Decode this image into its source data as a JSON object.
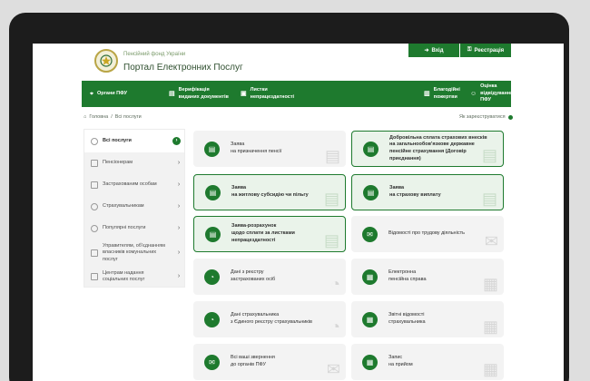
{
  "header": {
    "fund_name": "Пенсійний фонд України",
    "portal_title": "Портал Електронних Послуг",
    "login": "Вхід",
    "register": "Реєстрація"
  },
  "nav": {
    "items": [
      {
        "label": "Органи ПФУ",
        "icon": "map-icon"
      },
      {
        "label_1": "Верифікація",
        "label_2": "виданих документів",
        "icon": "document-check-icon"
      },
      {
        "label_1": "Листки",
        "label_2": "непрацездатності",
        "icon": "camera-icon"
      },
      {
        "label_1": "Благодійні",
        "label_2": "пожертви",
        "icon": "gift-icon"
      },
      {
        "label_1": "Оцінка",
        "label_2": "відвідування ПФУ",
        "icon": "rating-icon"
      }
    ]
  },
  "breadcrumb": {
    "home": "Головна",
    "separator": "/",
    "current": "Всі послуги"
  },
  "register_status": "Як зареєструватися",
  "sidebar": {
    "items": [
      {
        "label": "Всі послуги",
        "active": true
      },
      {
        "label": "Пенсіонерам"
      },
      {
        "label": "Застрахованим особам"
      },
      {
        "label": "Страхувальникам"
      },
      {
        "label": "Популярні послуги"
      },
      {
        "label": "Управителям, об'єднанням власників комунальних послуг"
      },
      {
        "label": "Центрам надання соціальних послуг"
      }
    ]
  },
  "cards": [
    {
      "line1": "Заява",
      "line2": "на призначення пенсії",
      "highlighted": false,
      "bold_first": false
    },
    {
      "line1": "Добровільна сплата страхових внесків",
      "line2": "на загальнообов'язкове державне пенсійне страхування (Договір приєднання)",
      "highlighted": true,
      "bold_first": true
    },
    {
      "line1": "Заява",
      "line2": "на житлову субсидію чи пільгу",
      "highlighted": true,
      "bold_first": true
    },
    {
      "line1": "Заява",
      "line2": "на страхову виплату",
      "highlighted": true,
      "bold_first": true
    },
    {
      "line1": "Заява-розрахунок",
      "line2": "щодо сплати за листками непрацездатності",
      "highlighted": true,
      "bold_first": true
    },
    {
      "line1": "Відомості про трудову діяльність",
      "line2": "",
      "highlighted": false,
      "bold_first": false
    },
    {
      "line1": "Дані з реєстру",
      "line2": "застрахованих осіб",
      "highlighted": false,
      "bold_first": false
    },
    {
      "line1": "Електронна",
      "line2": "пенсійна справа",
      "highlighted": false,
      "bold_first": false
    },
    {
      "line1": "Дані страхувальника",
      "line2": "з Єдиного реєстру страхувальників",
      "highlighted": false,
      "bold_first": false
    },
    {
      "line1": "Звітні відомості",
      "line2": "страхувальника",
      "highlighted": false,
      "bold_first": false
    },
    {
      "line1": "Всі ваші звернення",
      "line2": "до органів ПФУ",
      "highlighted": false,
      "bold_first": false
    },
    {
      "line1": "Запис",
      "line2": "на прийом",
      "highlighted": false,
      "bold_first": false
    }
  ],
  "colors": {
    "brand_green": "#1e7a2e",
    "highlight_bg": "#eaf3ea",
    "card_bg": "#f3f3f3"
  }
}
